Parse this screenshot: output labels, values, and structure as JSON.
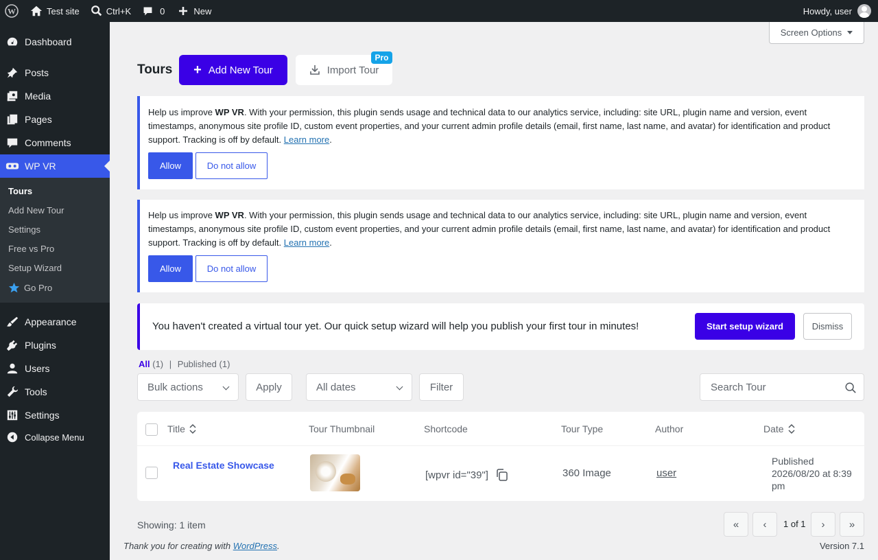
{
  "adminbar": {
    "site_name": "Test site",
    "search_shortcut": "Ctrl+K",
    "comments_count": "0",
    "new_label": "New",
    "howdy": "Howdy, user"
  },
  "sidebar": {
    "items": [
      {
        "label": "Dashboard",
        "icon": "dashboard-icon"
      },
      {
        "label": "Posts",
        "icon": "pin-icon"
      },
      {
        "label": "Media",
        "icon": "media-icon"
      },
      {
        "label": "Pages",
        "icon": "pages-icon"
      },
      {
        "label": "Comments",
        "icon": "comment-icon"
      },
      {
        "label": "WP VR",
        "icon": "vr-headset-icon"
      },
      {
        "label": "Appearance",
        "icon": "brush-icon"
      },
      {
        "label": "Plugins",
        "icon": "plug-icon"
      },
      {
        "label": "Users",
        "icon": "user-icon"
      },
      {
        "label": "Tools",
        "icon": "wrench-icon"
      },
      {
        "label": "Settings",
        "icon": "sliders-icon"
      },
      {
        "label": "Collapse Menu",
        "icon": "collapse-icon"
      }
    ],
    "submenu": [
      "Tours",
      "Add New Tour",
      "Settings",
      "Free vs Pro",
      "Setup Wizard",
      "Go Pro"
    ]
  },
  "screen_options": "Screen Options",
  "header": {
    "title": "Tours",
    "add_new": "Add New Tour",
    "import": "Import Tour",
    "pro_badge": "Pro"
  },
  "notice": {
    "text_before": "Help us improve ",
    "brand": "WP VR",
    "text_after": ". With your permission, this plugin sends usage and technical data to our analytics service, including: site URL, plugin name and version, event timestamps, anonymous site profile ID, custom event properties, and your current admin profile details (email, first name, last name, and avatar) for identification and product support. Tracking is off by default. ",
    "learn_more": "Learn more",
    "period": ".",
    "allow": "Allow",
    "deny": "Do not allow"
  },
  "setup_notice": {
    "text": "You haven't created a virtual tour yet. Our quick setup wizard will help you publish your first tour in minutes!",
    "start": "Start setup wizard",
    "dismiss": "Dismiss"
  },
  "views": {
    "all": "All",
    "all_count": "(1)",
    "sep": "|",
    "published": "Published",
    "published_count": "(1)"
  },
  "filters": {
    "bulk_actions": "Bulk actions",
    "apply": "Apply",
    "all_dates": "All dates",
    "filter": "Filter",
    "search_placeholder": "Search Tour"
  },
  "table": {
    "columns": [
      "Title",
      "Tour Thumbnail",
      "Shortcode",
      "Tour Type",
      "Author",
      "Date"
    ],
    "rows": [
      {
        "title": "Real Estate Showcase",
        "shortcode": "[wpvr id=\"39\"]",
        "type": "360 Image",
        "author": "user",
        "date_status": "Published",
        "date_value": "2026/08/20 at 8:39",
        "date_suffix": "pm"
      }
    ]
  },
  "pagination": {
    "showing": "Showing: 1 item",
    "first": "«",
    "prev": "‹",
    "count": "1 of 1",
    "next": "›",
    "last": "»"
  },
  "footer": {
    "thanks_before": "Thank you for creating with ",
    "wordpress": "WordPress",
    "thanks_after": ".",
    "version": "Version 7.1"
  },
  "colors": {
    "accent": "#3a00e6",
    "wp_blue": "#3858e9",
    "admin_dark": "#1d2327"
  }
}
